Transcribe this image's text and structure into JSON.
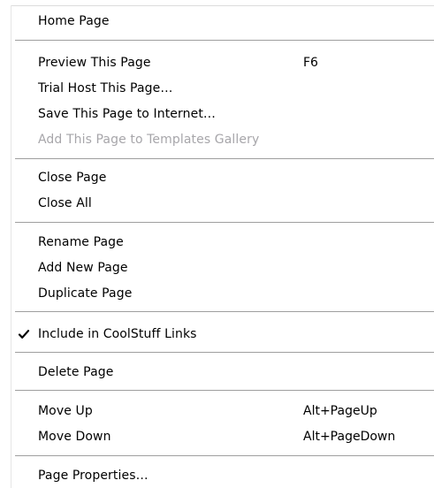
{
  "menu": {
    "items": [
      {
        "label": "Home Page",
        "shortcut": "",
        "disabled": false
      },
      {
        "label": "Preview This Page",
        "shortcut": "F6",
        "disabled": false
      },
      {
        "label": "Trial Host This Page…",
        "shortcut": "",
        "disabled": false
      },
      {
        "label": "Save This Page to Internet…",
        "shortcut": "",
        "disabled": false
      },
      {
        "label": "Add This Page to Templates Gallery",
        "shortcut": "",
        "disabled": true
      },
      {
        "label": "Close Page",
        "shortcut": "",
        "disabled": false
      },
      {
        "label": "Close All",
        "shortcut": "",
        "disabled": false
      },
      {
        "label": "Rename Page",
        "shortcut": "",
        "disabled": false
      },
      {
        "label": "Add New Page",
        "shortcut": "",
        "disabled": false
      },
      {
        "label": "Duplicate Page",
        "shortcut": "",
        "disabled": false
      },
      {
        "label": "Include in CoolStuff Links",
        "shortcut": "",
        "disabled": false,
        "checked": true
      },
      {
        "label": "Delete Page",
        "shortcut": "",
        "disabled": false
      },
      {
        "label": "Move Up",
        "shortcut": "Alt+PageUp",
        "disabled": false
      },
      {
        "label": "Move Down",
        "shortcut": "Alt+PageDown",
        "disabled": false
      },
      {
        "label": "Page Properties…",
        "shortcut": "",
        "disabled": false
      }
    ]
  },
  "icons": {
    "check": "checkmark-icon"
  },
  "colors": {
    "text": "#000000",
    "disabled_text": "#a7a6aa",
    "separator": "#9f9f9f",
    "background": "#ffffff"
  }
}
